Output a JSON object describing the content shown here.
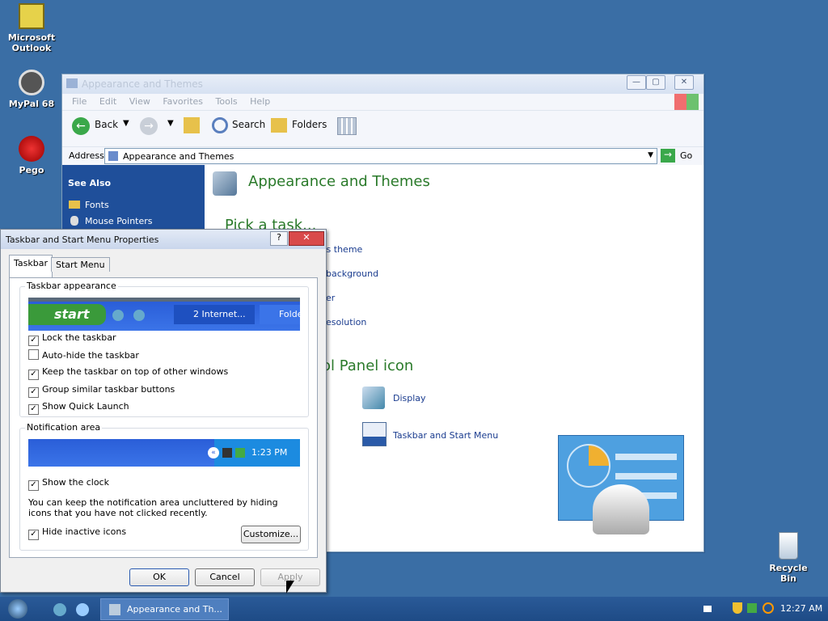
{
  "desktop": {
    "icons": [
      {
        "label": "Microsoft Outlook"
      },
      {
        "label": "MyPal 68"
      },
      {
        "label": "Pego"
      },
      {
        "label": "Recycle Bin"
      }
    ]
  },
  "explorer": {
    "title": "Appearance and Themes",
    "menu": [
      "File",
      "Edit",
      "View",
      "Favorites",
      "Tools",
      "Help"
    ],
    "toolbar": {
      "back": "Back",
      "search": "Search",
      "folders": "Folders"
    },
    "address": {
      "label": "Address",
      "value": "Appearance and Themes",
      "go": "Go"
    },
    "sidebar": {
      "heading": "See Also",
      "items": [
        "Fonts",
        "Mouse Pointers"
      ]
    },
    "content": {
      "heading": "Appearance and Themes",
      "pick_task": "Pick a task...",
      "tasks_visible": [
        "r's theme",
        "background",
        "er",
        "esolution"
      ],
      "cp_icon_heading": "ol Panel icon",
      "icons": [
        "Display",
        "Taskbar and Start Menu"
      ]
    }
  },
  "dialog": {
    "title": "Taskbar and Start Menu Properties",
    "tabs": [
      "Taskbar",
      "Start Menu"
    ],
    "appearance_group": "Taskbar appearance",
    "preview": {
      "start": "start",
      "task1": "2 Internet...",
      "task2": "Folde"
    },
    "checks": [
      {
        "label": "Lock the taskbar",
        "checked": true
      },
      {
        "label": "Auto-hide the taskbar",
        "checked": false
      },
      {
        "label": "Keep the taskbar on top of other windows",
        "checked": true
      },
      {
        "label": "Group similar taskbar buttons",
        "checked": true
      },
      {
        "label": "Show Quick Launch",
        "checked": true
      }
    ],
    "notification_group": "Notification area",
    "tray_time": "1:23 PM",
    "show_clock": "Show the clock",
    "note": "You can keep the notification area uncluttered by hiding icons that you have not clicked recently.",
    "hide_inactive": "Hide inactive icons",
    "customize": "Customize...",
    "buttons": {
      "ok": "OK",
      "cancel": "Cancel",
      "apply": "Apply"
    }
  },
  "taskbar": {
    "task": "Appearance and Th...",
    "clock": "12:27 AM"
  }
}
